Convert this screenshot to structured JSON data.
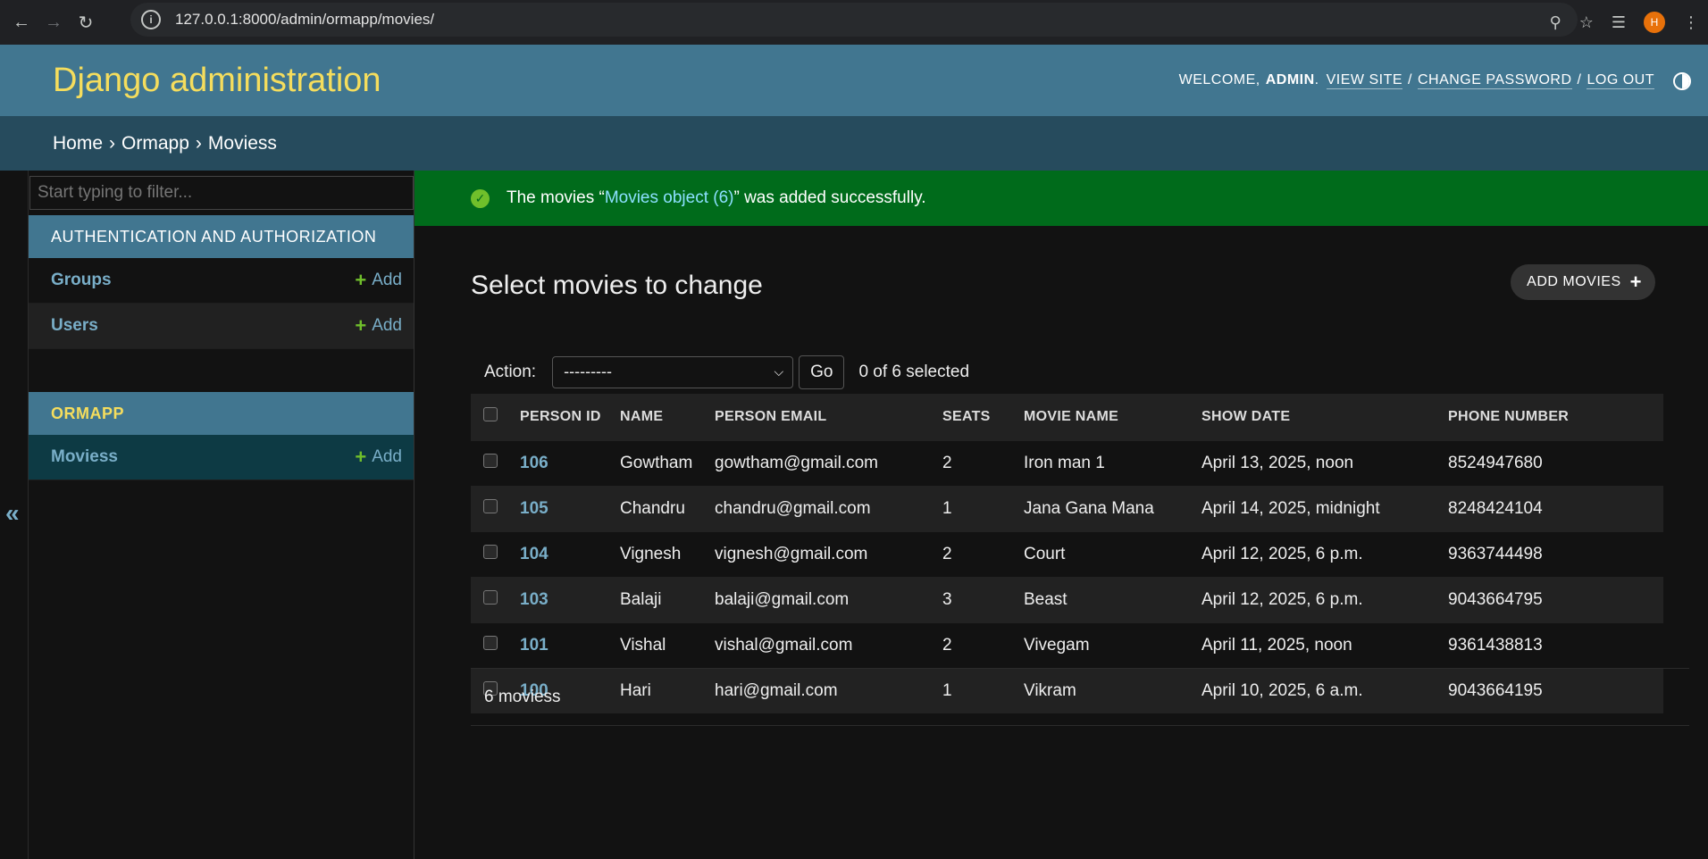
{
  "browser": {
    "url": "127.0.0.1:8000/admin/ormapp/movies/",
    "avatar_letter": "H"
  },
  "header": {
    "branding": "Django administration",
    "welcome": "WELCOME,",
    "username": "ADMIN",
    "period": ".",
    "view_site": "VIEW SITE",
    "change_password": "CHANGE PASSWORD",
    "log_out": "LOG OUT",
    "slash": "/"
  },
  "breadcrumbs": {
    "home": "Home",
    "app": "Ormapp",
    "current": "Moviess",
    "sep": "›"
  },
  "sidebar": {
    "collapse_label": "«",
    "filter_placeholder": "Start typing to filter...",
    "modules": [
      {
        "caption": "AUTHENTICATION AND AUTHORIZATION",
        "models": [
          {
            "name": "Groups",
            "add": "Add"
          },
          {
            "name": "Users",
            "add": "Add"
          }
        ]
      },
      {
        "caption": "ORMAPP",
        "models": [
          {
            "name": "Moviess",
            "add": "Add"
          }
        ]
      }
    ]
  },
  "message": {
    "prefix": "The movies “",
    "link": "Movies object (6)",
    "suffix": "” was added successfully."
  },
  "content": {
    "title": "Select movies to change",
    "add_button": "ADD MOVIES",
    "action_label": "Action:",
    "action_selected": "---------",
    "go": "Go",
    "counter": "0 of 6 selected",
    "paginator": "6 moviess"
  },
  "table": {
    "columns": [
      "PERSON ID",
      "NAME",
      "PERSON EMAIL",
      "SEATS",
      "MOVIE NAME",
      "SHOW DATE",
      "PHONE NUMBER"
    ],
    "rows": [
      {
        "id": "106",
        "name": "Gowtham",
        "email": "gowtham@gmail.com",
        "seats": "2",
        "movie": "Iron man 1",
        "date": "April 13, 2025, noon",
        "phone": "8524947680"
      },
      {
        "id": "105",
        "name": "Chandru",
        "email": "chandru@gmail.com",
        "seats": "1",
        "movie": "Jana Gana Mana",
        "date": "April 14, 2025, midnight",
        "phone": "8248424104"
      },
      {
        "id": "104",
        "name": "Vignesh",
        "email": "vignesh@gmail.com",
        "seats": "2",
        "movie": "Court",
        "date": "April 12, 2025, 6 p.m.",
        "phone": "9363744498"
      },
      {
        "id": "103",
        "name": "Balaji",
        "email": "balaji@gmail.com",
        "seats": "3",
        "movie": "Beast",
        "date": "April 12, 2025, 6 p.m.",
        "phone": "9043664795"
      },
      {
        "id": "101",
        "name": "Vishal",
        "email": "vishal@gmail.com",
        "seats": "2",
        "movie": "Vivegam",
        "date": "April 11, 2025, noon",
        "phone": "9361438813"
      },
      {
        "id": "100",
        "name": "Hari",
        "email": "hari@gmail.com",
        "seats": "1",
        "movie": "Vikram",
        "date": "April 10, 2025, 6 a.m.",
        "phone": "9043664195"
      }
    ]
  },
  "colors": {
    "header_bg": "#417690",
    "breadcrumb_bg": "#264b5d",
    "branding": "#f5dd5d",
    "link": "#79aec8",
    "success_bg": "#006b1b",
    "add_green": "#70bf2b"
  }
}
